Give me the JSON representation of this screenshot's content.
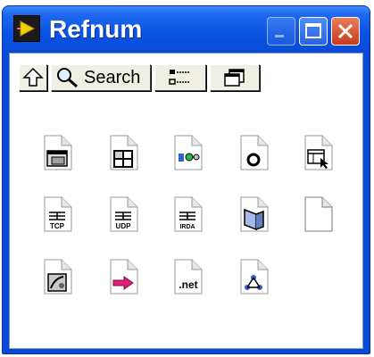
{
  "window": {
    "title": "Refnum",
    "app_icon": "labview-icon"
  },
  "caption_buttons": [
    {
      "name": "minimize",
      "icon": "minimize-icon"
    },
    {
      "name": "maximize",
      "icon": "maximize-icon"
    },
    {
      "name": "close",
      "icon": "close-icon"
    }
  ],
  "toolbar": {
    "up_icon": "up-arrow-icon",
    "search_label": "Search",
    "search_icon": "magnifier-icon",
    "options_icon": "view-options-icon",
    "window_icon": "restore-window-icon"
  },
  "palette_items": [
    {
      "icon": "file-window-icon"
    },
    {
      "icon": "file-grid-icon"
    },
    {
      "icon": "file-device-icon"
    },
    {
      "icon": "file-circle-icon"
    },
    {
      "icon": "file-pointer-icon"
    },
    {
      "icon": "file-tcp-icon",
      "label": "TCP"
    },
    {
      "icon": "file-udp-icon",
      "label": "UDP"
    },
    {
      "icon": "file-irda-icon",
      "label": "IRDA"
    },
    {
      "icon": "file-book-icon"
    },
    {
      "icon": "blank-file-icon"
    },
    {
      "icon": "file-image-icon"
    },
    {
      "icon": "file-arrow-icon"
    },
    {
      "icon": "file-net-icon",
      "label": ".net"
    },
    {
      "icon": "file-network-icon"
    }
  ],
  "colors": {
    "titlebar": "#0a49d8",
    "close_button": "#c83b1c",
    "client_background": "#ffffff",
    "toolbar_button": "#efefe4"
  }
}
